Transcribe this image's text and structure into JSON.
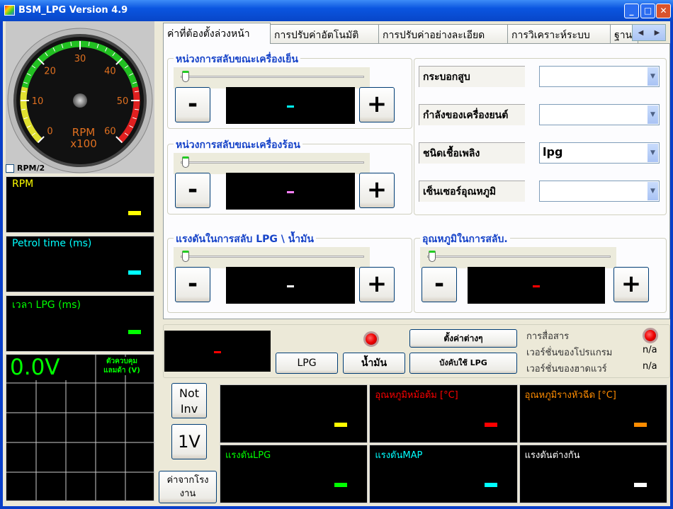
{
  "window": {
    "title": "BSM_LPG    Version 4.9"
  },
  "gauge": {
    "ticks": [
      "0",
      "10",
      "20",
      "30",
      "40",
      "50",
      "60"
    ],
    "unit": "RPM",
    "multiplier": "x100",
    "value": 0
  },
  "rpm2_checkbox": {
    "label": "RPM/2",
    "checked": false
  },
  "left_panels": [
    {
      "label": "RPM",
      "color": "#ffff00"
    },
    {
      "label": "Petrol time (ms)",
      "color": "#00ffff"
    },
    {
      "label": "เวลา LPG (ms)",
      "color": "#00ff00"
    }
  ],
  "lambda": {
    "value": "0.0V",
    "label1": "ตัวควบคุม",
    "label2": "แลมด้า (V)"
  },
  "tabs": [
    "ค่าที่ต้องตั้งล่วงหน้า",
    "การปรับค่าอัตโนมัติ",
    "การปรับค่าอย่างละเอียด",
    "การวิเคราะห์ระบบ",
    "ฐาน"
  ],
  "groups": {
    "cold": {
      "title": "หน่วงการสลับขณะเครื่องเย็น",
      "value": "-",
      "color": "#00ffff"
    },
    "hot": {
      "title": "หน่วงการสลับขณะเครื่องร้อน",
      "value": "-",
      "color": "#ff80ff"
    },
    "pressure": {
      "title": "แรงดันในการสลับ LPG \\ น้ำมัน",
      "value": "-",
      "color": "#ffffff"
    },
    "temp": {
      "title": "อุณหภูมิในการสลับ.",
      "value": "-",
      "color": "#ff0000"
    }
  },
  "buttons": {
    "minus": "-",
    "plus": "+",
    "lpg": "LPG",
    "petrol": "น้ำมัน",
    "settings": "ตั้งค่าต่างๆ",
    "force_lpg": "บังคับใช้ LPG",
    "not_inv": [
      "Not",
      "Inv"
    ],
    "one_v": "1V",
    "factory": [
      "ค่าจากโรง",
      "งาน"
    ]
  },
  "fields": [
    {
      "label": "กระบอกสูบ",
      "value": ""
    },
    {
      "label": "กำลังของเครื่องยนต์",
      "value": ""
    },
    {
      "label": "ชนิดเชื้อเพลิง",
      "value": "lpg"
    },
    {
      "label": "เซ็นเซอร์อุณหภูมิ",
      "value": ""
    }
  ],
  "status": {
    "comm_label": "การสื่อสาร",
    "sw_label": "เวอร์ชั่นของโปรแกรม",
    "sw_value": "n/a",
    "hw_label": "เวอร์ชั่นของฮาดแวร์",
    "hw_value": "n/a",
    "mode_value": "-"
  },
  "sensors": [
    {
      "label": "",
      "color": "#ffff00"
    },
    {
      "label": "อุณหภูมิหม้อต้ม [°C]",
      "color": "#ff0000"
    },
    {
      "label": "อุณหภูมิรางหัวฉีด [°C]",
      "color": "#ff8c00"
    },
    {
      "label": "แรงดันLPG",
      "color": "#00ff00"
    },
    {
      "label": "แรงดันMAP",
      "color": "#00ffff"
    },
    {
      "label": "แรงดันต่างกัน",
      "color": "#ffffff"
    }
  ]
}
